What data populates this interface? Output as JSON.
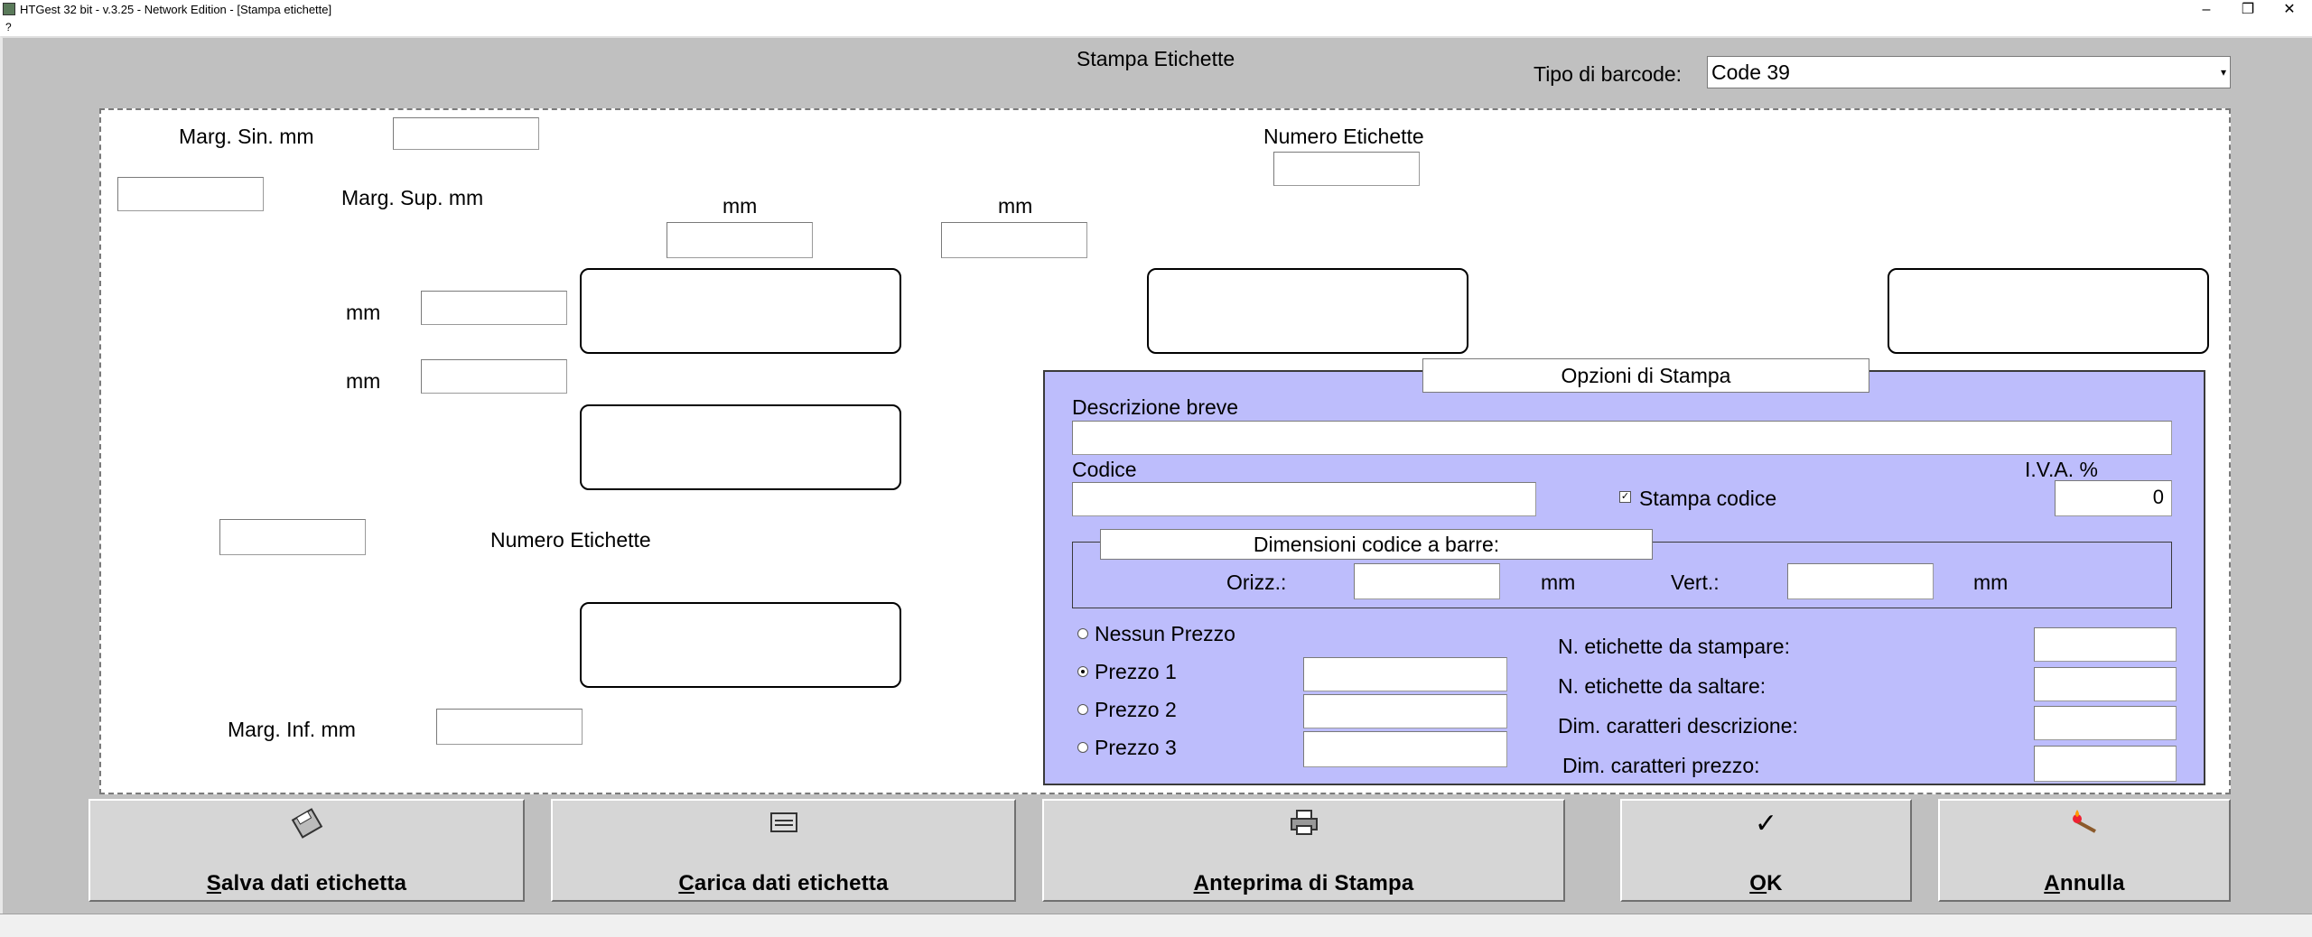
{
  "window": {
    "title": "HTGest 32 bit - v.3.25 - Network Edition - [Stampa etichette]",
    "minimize": "–",
    "maximize": "❐",
    "close": "✕"
  },
  "menu": {
    "help": "?"
  },
  "header": {
    "title": "Stampa Etichette",
    "barcode_type_label": "Tipo di barcode:",
    "barcode_type_value": "Code 39"
  },
  "layout_panel": {
    "marg_sin_label": "Marg. Sin. mm",
    "marg_sup_label": "Marg. Sup. mm",
    "marg_inf_label": "Marg. Inf. mm",
    "numero_etichette_top": "Numero Etichette",
    "numero_etichette_left": "Numero Etichette",
    "mm_col1": "mm",
    "mm_col2": "mm",
    "mm_row1": "mm",
    "mm_row2": "mm"
  },
  "options": {
    "title": "Opzioni di Stampa",
    "descrizione_label": "Descrizione breve",
    "descrizione_value": "",
    "codice_label": "Codice",
    "codice_value": "",
    "stampa_codice_label": "Stampa codice",
    "stampa_codice_checked": true,
    "iva_label": "I.V.A. %",
    "iva_value": "0",
    "dimensioni_title": "Dimensioni codice a barre:",
    "orizz_label": "Orizz.:",
    "orizz_unit": "mm",
    "vert_label": "Vert.:",
    "vert_unit": "mm",
    "prices": [
      {
        "label": "Nessun Prezzo",
        "selected": false
      },
      {
        "label": "Prezzo 1",
        "selected": true
      },
      {
        "label": "Prezzo 2",
        "selected": false
      },
      {
        "label": "Prezzo 3",
        "selected": false
      }
    ],
    "n_stampare_label": "N. etichette da stampare:",
    "n_saltare_label": "N. etichette da saltare:",
    "dim_descrizione_label": "Dim. caratteri descrizione:",
    "dim_prezzo_label": "Dim. caratteri prezzo:"
  },
  "buttons": {
    "salva": {
      "underline": "S",
      "rest": "alva dati etichetta",
      "icon": "save-disk-icon"
    },
    "carica": {
      "underline": "C",
      "rest": "arica dati etichetta",
      "icon": "load-card-icon"
    },
    "anteprima": {
      "underline": "A",
      "rest": "nteprima di Stampa",
      "icon": "printer-icon"
    },
    "ok": {
      "underline": "O",
      "rest": "K",
      "icon": "checkmark-icon"
    },
    "annulla": {
      "underline": "A",
      "rest": "nnulla",
      "icon": "cancel-match-icon"
    }
  }
}
